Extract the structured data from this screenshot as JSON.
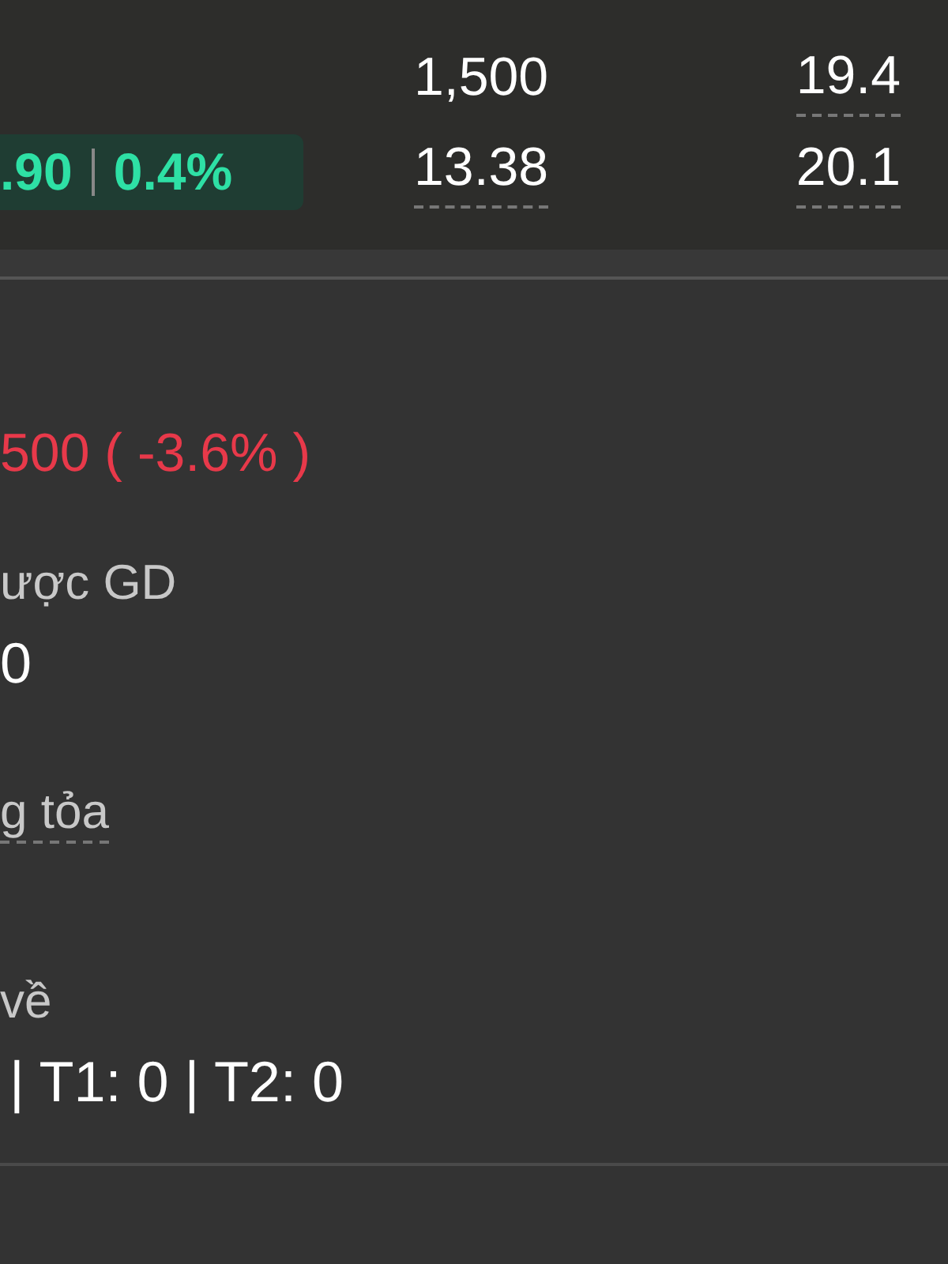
{
  "quote_header": {
    "change": ".90",
    "change_percent": "0.4%",
    "positive": true,
    "stats": [
      {
        "text": "1,500",
        "has_tooltip": false
      },
      {
        "text": "19.4",
        "has_tooltip": true
      },
      {
        "text": "13.38",
        "has_tooltip": true
      },
      {
        "text": "20.1",
        "has_tooltip": true
      }
    ]
  },
  "price_change": {
    "text": "500 ( -3.6% )",
    "positive": false
  },
  "fields": [
    {
      "label": "ược GD",
      "label_tooltip": false,
      "value": "0"
    },
    {
      "label": "g tỏa",
      "label_tooltip": true
    },
    {
      "label": "về",
      "label_tooltip": false,
      "value": "| T1: 0 | T2: 0"
    }
  ]
}
